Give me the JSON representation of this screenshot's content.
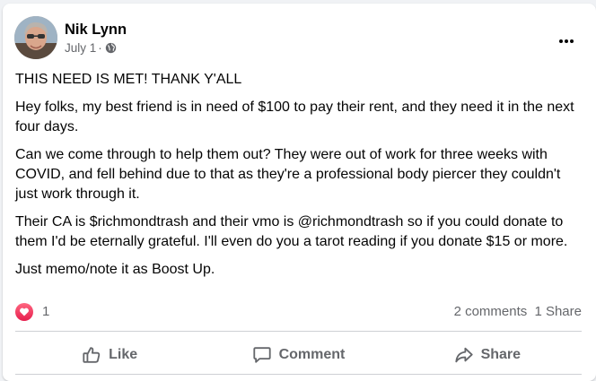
{
  "post": {
    "author": "Nik Lynn",
    "date": "July 1",
    "separator": "·",
    "paragraphs": [
      "THIS NEED IS MET! THANK Y'ALL",
      "Hey folks, my best friend is in need of $100 to pay their rent, and they need it in the next four days.",
      "Can we come through to help them out? They were out of work for three weeks with COVID, and fell behind due to that as they're a professional body piercer they couldn't just work through it.",
      "Their CA is $richmondtrash and their vmo is @richmondtrash so if you could donate to them I'd be eternally grateful. I'll even do you a tarot reading if you donate $15 or more.",
      "Just memo/note it as Boost Up."
    ]
  },
  "stats": {
    "reaction_count": "1",
    "comments": "2 comments",
    "shares": "1 Share"
  },
  "actions": {
    "like": "Like",
    "comment": "Comment",
    "share": "Share"
  },
  "icons": {
    "privacy": "globe-icon",
    "reaction": "love-reaction-icon",
    "more": "more-options-icon",
    "like": "thumbs-up-icon",
    "comment": "comment-bubble-icon",
    "share": "share-arrow-icon"
  },
  "colors": {
    "text": "#050505",
    "secondary": "#65676b",
    "love": "#e61e4d",
    "divider": "#ced0d4"
  }
}
